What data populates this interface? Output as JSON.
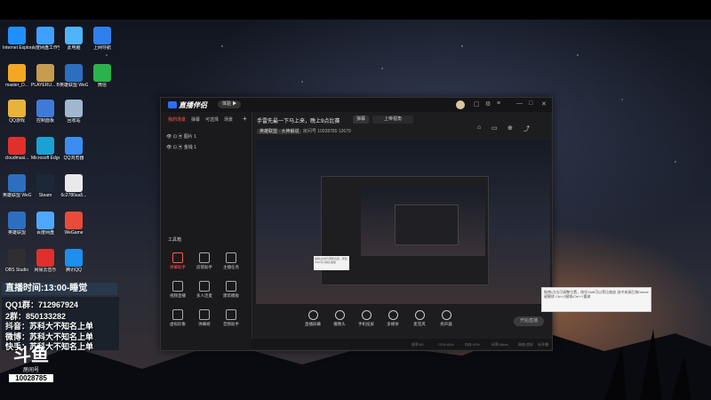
{
  "desktop_icons": [
    {
      "label": "Internet Explorer",
      "color": "#1e90ff"
    },
    {
      "label": "百度网盘工作空间",
      "color": "#3fa0ff"
    },
    {
      "label": "此电脑",
      "color": "#4fb3ff"
    },
    {
      "label": "上网导航",
      "color": "#2f80ed"
    },
    {
      "label": "master_D...",
      "color": "#f5a623"
    },
    {
      "label": "PLAYERU... BATTLEGR...",
      "color": "#c69c4f"
    },
    {
      "label": "英雄联盟 WeGame版",
      "color": "#2c6fbf"
    },
    {
      "label": "微信",
      "color": "#2bb24c"
    },
    {
      "label": "QQ游戏",
      "color": "#e8b339"
    },
    {
      "label": "控制面板",
      "color": "#3f7ad9"
    },
    {
      "label": "回收站",
      "color": "#9fb8d0"
    },
    {
      "label": "cloudmusi...",
      "color": "#e0302c"
    },
    {
      "label": "Microsoft Edge",
      "color": "#1aa1d6"
    },
    {
      "label": "QQ浏览器",
      "color": "#3b8df1"
    },
    {
      "label": "英雄联盟 WeGame版",
      "color": "#2c6fbf"
    },
    {
      "label": "Steam",
      "color": "#1b2838"
    },
    {
      "label": "6c2780aa5...",
      "color": "#e9e9e9"
    },
    {
      "label": "英雄联盟",
      "color": "#2c6fbf"
    },
    {
      "label": "百度网盘",
      "color": "#4fa8ff"
    },
    {
      "label": "WeGame",
      "color": "#e84b3a"
    },
    {
      "label": "OBS Studio",
      "color": "#302e31"
    },
    {
      "label": "网易云音乐",
      "color": "#e0302c"
    },
    {
      "label": "腾讯QQ",
      "color": "#1c8fef"
    }
  ],
  "app": {
    "name": "直播伴侣",
    "version_button": "体验 ▶",
    "tabs": [
      "我的场景",
      "弹幕",
      "可选择",
      "场景"
    ],
    "scenes": [
      "图片 1",
      "金钱 1"
    ],
    "toolbox_title": "工具箱",
    "tools": [
      {
        "label": "弹幕助手",
        "active": true
      },
      {
        "label": "房管助手"
      },
      {
        "label": "主播任务"
      },
      {
        "label": "视频直播"
      },
      {
        "label": "多人连麦"
      },
      {
        "label": "建筑模板"
      },
      {
        "label": "虚拟形象"
      },
      {
        "label": "弹幕姬"
      },
      {
        "label": "音频助手"
      }
    ],
    "stream_title": "手雷先最一下马上来，晚上9点比赛",
    "category": "弹幕",
    "category_button": "上帝视角",
    "tag": "英雄联盟 · 大神解说",
    "room_line": "房间号 10028785",
    "followers": "12679",
    "bottom_buttons": [
      "直播屏幕",
      "摄像头",
      "手机投屏",
      "多媒体",
      "麦克风",
      "扬声器"
    ],
    "start_live": "开始直播",
    "callout_text": "拖拽/点击可调整位置，按住Shift可以等比缩放",
    "bigcallout_text": "拖拽/点击可调整位置，按住Shift可以等比缩放 选中来源后按Delete键删除 Ctrl+Z撤销/Ctrl+Y重做",
    "status": [
      "帧率:60",
      "CPU:40%",
      "内存:40%",
      "码率:0kb/s",
      "网络:良好",
      "未开播"
    ]
  },
  "overlay": {
    "time_line": "直播时间:13:00-睡觉",
    "qq1": "QQ1群：712967924",
    "qq2": "2群：850133282",
    "douyin": "抖音：苏科大不知名上单",
    "weibo": "微博：苏科大不知名上单",
    "kuaishou": "快手：苏科大不知名上单",
    "logo_mark": "斗鱼",
    "room_label": "房间号",
    "room_number": "10028785"
  }
}
